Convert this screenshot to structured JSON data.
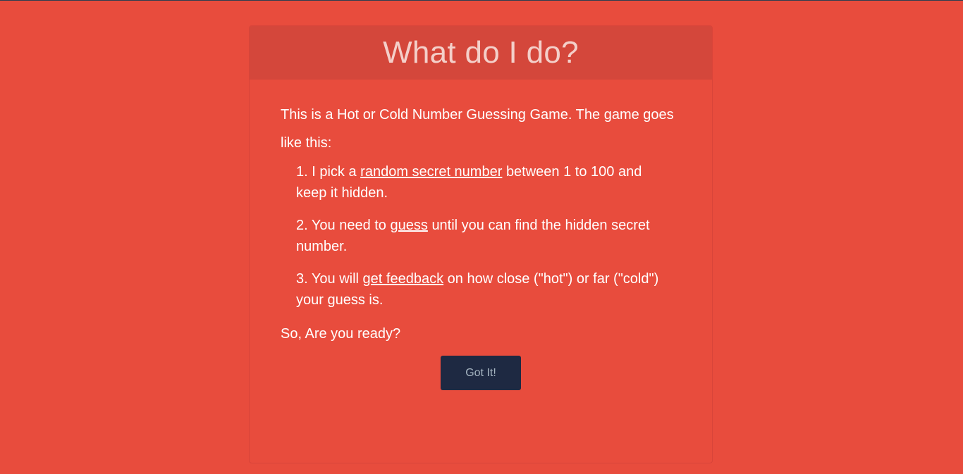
{
  "modal": {
    "title": "What do I do?",
    "intro": "This is a Hot or Cold Number Guessing Game. The game goes like this:",
    "steps": [
      {
        "number": "1.",
        "before": "I pick a",
        "link": "random secret number",
        "after": "between 1 to 100 and keep it hidden."
      },
      {
        "number": "2.",
        "before": "You need to",
        "link": "guess",
        "after": "until you can find the hidden secret number."
      },
      {
        "number": "3.",
        "before": "You will",
        "link": "get feedback",
        "after": "on how close (\"hot\") or far (\"cold\") your guess is."
      }
    ],
    "outro": "So, Are you ready?",
    "button_label": "Got It!"
  },
  "colors": {
    "page_background": "#e84c3d",
    "header_background": "#d4473b",
    "title_text": "#f4cfc9",
    "button_background": "#1e2942",
    "button_text": "#a7b6c2"
  }
}
